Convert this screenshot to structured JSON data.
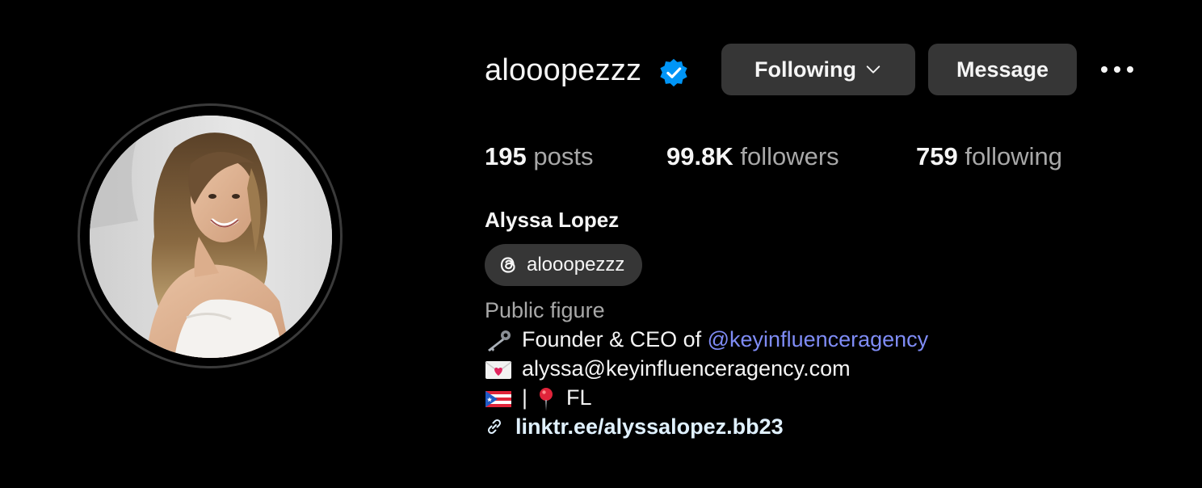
{
  "profile": {
    "username": "alooopezzz",
    "verified": true,
    "full_name": "Alyssa Lopez",
    "category": "Public figure"
  },
  "actions": {
    "following_label": "Following",
    "message_label": "Message"
  },
  "stats": {
    "posts_count": "195",
    "posts_label": "posts",
    "followers_count": "99.8K",
    "followers_label": "followers",
    "following_count": "759",
    "following_label": "following"
  },
  "threads": {
    "handle": "alooopezzz",
    "icon": "threads-icon"
  },
  "bio": {
    "line1_prefix": "Founder & CEO of",
    "line1_mention": "@keyinfluenceragency",
    "line1_icon": "key-icon",
    "line2_text": "alyssa@keyinfluenceragency.com",
    "line2_icon": "love-letter-icon",
    "line3_flag_icon": "puerto-rico-flag-icon",
    "line3_separator": "|",
    "line3_pin_icon": "round-pushpin-icon",
    "line3_text": "FL"
  },
  "link": {
    "text": "linktr.ee/alyssalopez.bb23",
    "icon": "link-icon"
  },
  "colors": {
    "background": "#000000",
    "button_bg": "#363636",
    "primary_text": "#f5f5f5",
    "secondary_text": "#a8a8a8",
    "mention": "#7f8cf6",
    "link": "#e0f1ff",
    "verified": "#0095f6"
  }
}
